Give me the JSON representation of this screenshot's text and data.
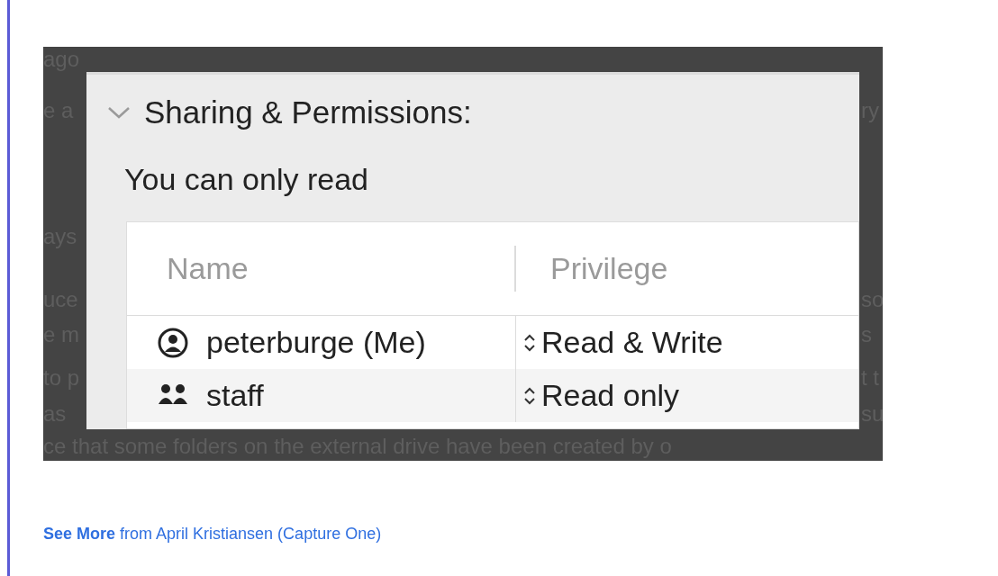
{
  "image": {
    "background_text": {
      "left": [
        "ago",
        "e a",
        "ays",
        "uce",
        "e m",
        "to p",
        "as"
      ],
      "right": [
        "ry",
        "so",
        "s",
        "t t",
        "su"
      ],
      "bottom": "ce that some folders on the external drive have been created by o"
    },
    "panel": {
      "expanded": true,
      "title": "Sharing & Permissions:",
      "subtitle": "You can only read",
      "columns": [
        "Name",
        "Privilege"
      ],
      "rows": [
        {
          "kind": "user",
          "name": "peterburge (Me)",
          "privilege": "Read & Write",
          "selected": false
        },
        {
          "kind": "group",
          "name": "staff",
          "privilege": "Read only",
          "selected": false
        }
      ]
    }
  },
  "footer": {
    "link_bold": "See More",
    "link_rest": "from April Kristiansen (Capture One)"
  }
}
